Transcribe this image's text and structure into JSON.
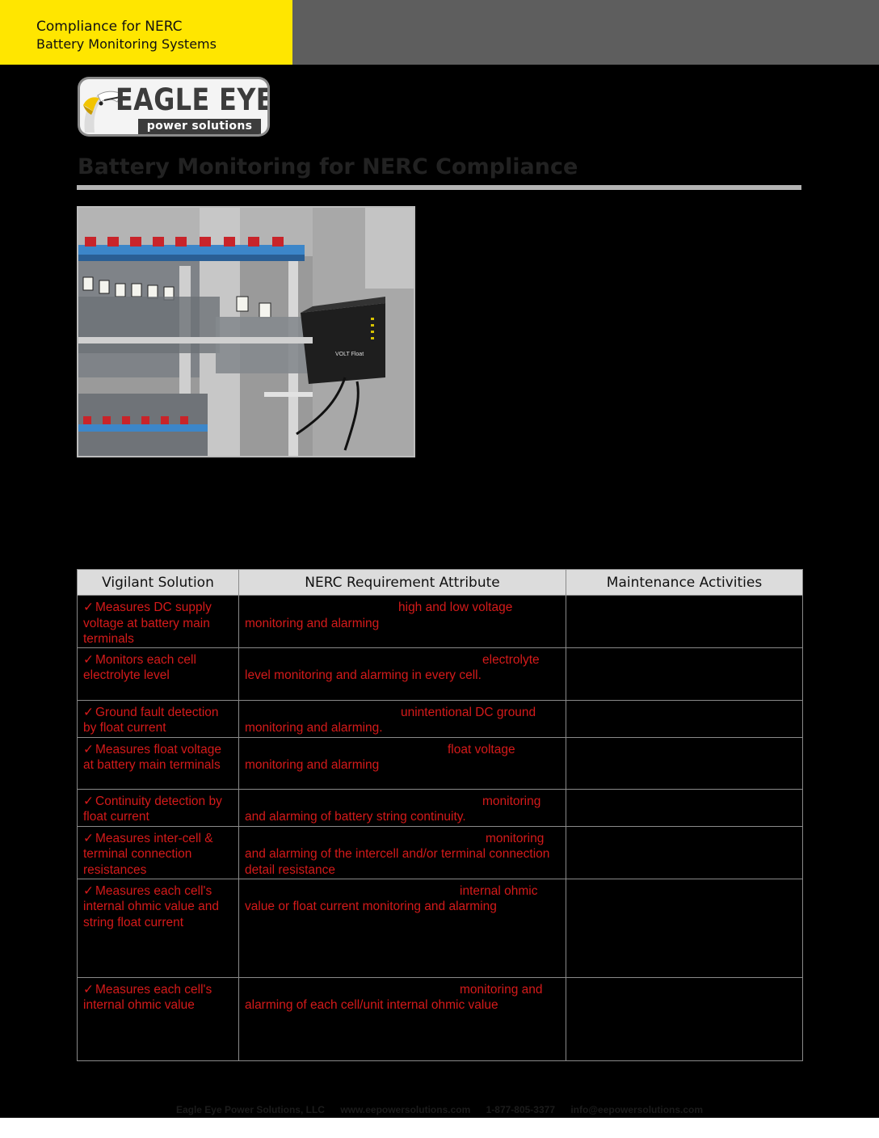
{
  "header": {
    "line1": "Compliance for NERC",
    "line2": "Battery Monitoring Systems",
    "accent_color": "#ffe600",
    "bar_color": "#5e5e5e"
  },
  "logo": {
    "brand": "EAGLE EYE",
    "sub": "power solutions",
    "icon": "eagle-head-icon"
  },
  "title": "Battery Monitoring for NERC Compliance",
  "photo": {
    "device_label": "VOLT Float"
  },
  "table": {
    "headers": [
      "Vigilant Solution",
      "NERC Requirement Attribute",
      "Maintenance Activities"
    ],
    "check_icon": "✓",
    "rows": [
      {
        "solution": "Measures DC supply voltage at battery main terminals",
        "req_highlight": "high and low voltage",
        "req_body": "monitoring and alarming",
        "height": 64
      },
      {
        "solution": "Monitors each cell electrolyte level",
        "req_highlight": "electrolyte",
        "req_body": "level monitoring and alarming in every cell.",
        "height": 65
      },
      {
        "solution": "Ground fault detection by float current",
        "req_highlight": "unintentional DC ground",
        "req_body": "monitoring and alarming.",
        "height": 46
      },
      {
        "solution": "Measures float voltage at battery main terminals",
        "req_highlight": "float voltage",
        "req_body": "monitoring and alarming",
        "height": 64
      },
      {
        "solution": "Continuity detection by float current",
        "req_highlight": "monitoring",
        "req_body": "and alarming of battery string continuity.",
        "height": 46
      },
      {
        "solution": "Measures inter-cell & terminal connection resistances",
        "req_highlight": "monitoring",
        "req_body": "and alarming of the intercell and/or terminal connection detail resistance",
        "height": 65
      },
      {
        "solution": "Measures each cell's internal ohmic value and string float current",
        "req_highlight": "internal ohmic",
        "req_body": "value or float current monitoring and alarming",
        "height": 122
      },
      {
        "solution": "Measures each cell's internal ohmic value",
        "req_highlight": "monitoring and",
        "req_body": "alarming of each cell/unit internal ohmic value",
        "height": 103
      }
    ]
  },
  "footer": {
    "company": "Eagle Eye Power Solutions, LLC",
    "website": "www.eepowersolutions.com",
    "phone": "1-877-805-3377",
    "email": "info@eepowersolutions.com"
  }
}
